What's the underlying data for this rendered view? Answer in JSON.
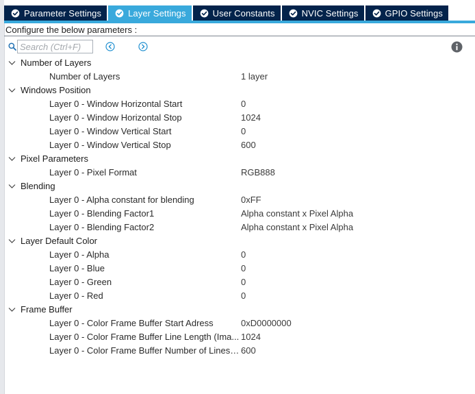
{
  "tabs": [
    {
      "label": "Parameter Settings",
      "active": false
    },
    {
      "label": "Layer Settings",
      "active": true
    },
    {
      "label": "User Constants",
      "active": false
    },
    {
      "label": "NVIC Settings",
      "active": false
    },
    {
      "label": "GPIO Settings",
      "active": false
    }
  ],
  "config_label": "Configure the below parameters :",
  "search": {
    "placeholder": "Search (Ctrl+F)",
    "value": ""
  },
  "icons": {
    "tab_check": "check-circle-icon",
    "search": "search-icon",
    "prev": "previous-icon",
    "next": "next-icon",
    "info": "info-icon",
    "expand": "chevron-down-icon"
  },
  "colors": {
    "tab_bg": "#03234b",
    "tab_active_bg": "#39a9dc",
    "accent": "#39a9dc"
  },
  "groups": [
    {
      "label": "Number of Layers",
      "params": [
        {
          "label": "Number of Layers",
          "value": "1 layer"
        }
      ]
    },
    {
      "label": "Windows Position",
      "params": [
        {
          "label": "Layer 0 - Window Horizontal Start",
          "value": "0"
        },
        {
          "label": "Layer 0 - Window Horizontal Stop",
          "value": "1024"
        },
        {
          "label": "Layer 0 - Window Vertical Start",
          "value": "0"
        },
        {
          "label": "Layer 0 - Window Vertical Stop",
          "value": "600"
        }
      ]
    },
    {
      "label": "Pixel Parameters",
      "params": [
        {
          "label": "Layer 0 - Pixel Format",
          "value": "RGB888"
        }
      ]
    },
    {
      "label": "Blending",
      "params": [
        {
          "label": "Layer 0 - Alpha constant for blending",
          "value": "0xFF"
        },
        {
          "label": "Layer 0 - Blending Factor1",
          "value": "Alpha constant x Pixel Alpha"
        },
        {
          "label": "Layer 0 - Blending Factor2",
          "value": "Alpha constant x Pixel Alpha"
        }
      ]
    },
    {
      "label": "Layer Default Color",
      "params": [
        {
          "label": "Layer 0 - Alpha",
          "value": "0"
        },
        {
          "label": "Layer 0 - Blue",
          "value": "0"
        },
        {
          "label": "Layer 0 - Green",
          "value": "0"
        },
        {
          "label": "Layer 0 - Red",
          "value": "0"
        }
      ]
    },
    {
      "label": "Frame Buffer",
      "params": [
        {
          "label": "Layer 0 - Color Frame Buffer Start Adress",
          "value": "0xD0000000"
        },
        {
          "label": "Layer 0 - Color Frame Buffer Line Length (Ima...",
          "value": "1024"
        },
        {
          "label": "Layer 0 - Color Frame Buffer Number of Lines ...",
          "value": "600"
        }
      ]
    }
  ]
}
